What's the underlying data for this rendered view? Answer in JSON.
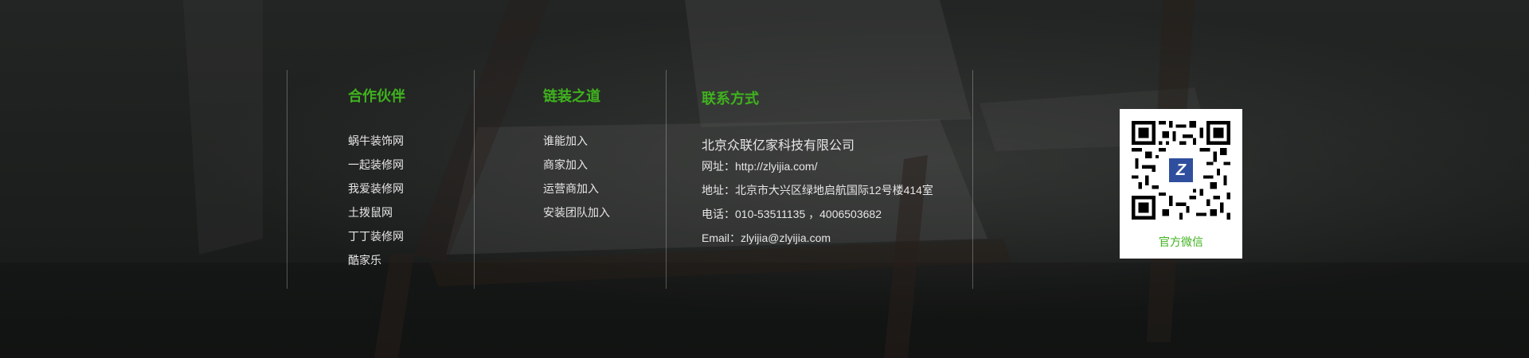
{
  "colors": {
    "accent": "#3fb21e",
    "text": "#e6e6e6",
    "background": "#1b1d1c"
  },
  "partners": {
    "title": "合作伙伴",
    "items": [
      "蜗牛装饰网",
      "一起装修网",
      "我爱装修网",
      "土拨鼠网",
      "丁丁装修网",
      "酷家乐"
    ]
  },
  "chain": {
    "title": "链装之道",
    "items": [
      "谁能加入",
      "商家加入",
      "运营商加入",
      "安装团队加入"
    ]
  },
  "contact": {
    "title": "联系方式",
    "company": "北京众联亿家科技有限公司",
    "website": "网址：http://zlyijia.com/",
    "address": "地址：北京市大兴区绿地启航国际12号楼414室",
    "phone": "电话：010-53511135 ，4006503682",
    "email": "Email：zlyijia@zlyijia.com"
  },
  "qr": {
    "caption": "官方微信",
    "icon": "qr-code-icon",
    "logo_letter": "Z"
  }
}
